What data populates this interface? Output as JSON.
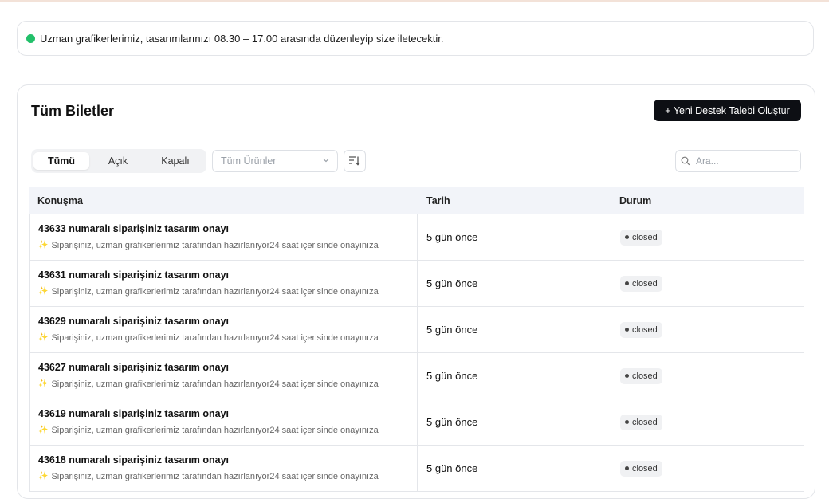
{
  "notice": {
    "text": "Uzman grafikerlerimiz, tasarımlarınızı 08.30 – 17.00 arasında düzenleyip size iletecektir.",
    "status_color": "#22c06a"
  },
  "card": {
    "title": "Tüm Biletler",
    "new_button": "+ Yeni Destek Talebi Oluştur"
  },
  "filters": {
    "tabs": [
      {
        "label": "Tümü",
        "active": true
      },
      {
        "label": "Açık",
        "active": false
      },
      {
        "label": "Kapalı",
        "active": false
      }
    ],
    "product_select": "Tüm Ürünler",
    "search_placeholder": "Ara..."
  },
  "table": {
    "headers": {
      "conversation": "Konuşma",
      "date": "Tarih",
      "status": "Durum"
    },
    "rows": [
      {
        "title": "43633 numaralı siparişiniz tasarım onayı",
        "desc": "Siparişiniz, uzman grafikerlerimiz tarafından hazırlanıyor24 saat içerisinde onayınıza",
        "date": "5 gün önce",
        "status": "closed"
      },
      {
        "title": "43631 numaralı siparişiniz tasarım onayı",
        "desc": "Siparişiniz, uzman grafikerlerimiz tarafından hazırlanıyor24 saat içerisinde onayınıza",
        "date": "5 gün önce",
        "status": "closed"
      },
      {
        "title": "43629 numaralı siparişiniz tasarım onayı",
        "desc": "Siparişiniz, uzman grafikerlerimiz tarafından hazırlanıyor24 saat içerisinde onayınıza",
        "date": "5 gün önce",
        "status": "closed"
      },
      {
        "title": "43627 numaralı siparişiniz tasarım onayı",
        "desc": "Siparişiniz, uzman grafikerlerimiz tarafından hazırlanıyor24 saat içerisinde onayınıza",
        "date": "5 gün önce",
        "status": "closed"
      },
      {
        "title": "43619 numaralı siparişiniz tasarım onayı",
        "desc": "Siparişiniz, uzman grafikerlerimiz tarafından hazırlanıyor24 saat içerisinde onayınıza",
        "date": "5 gün önce",
        "status": "closed"
      },
      {
        "title": "43618 numaralı siparişiniz tasarım onayı",
        "desc": "Siparişiniz, uzman grafikerlerimiz tarafından hazırlanıyor24 saat içerisinde onayınıza",
        "date": "5 gün önce",
        "status": "closed"
      }
    ]
  },
  "icons": {
    "status_dot": "dot-icon",
    "chevron": "chevron-down-icon",
    "sort": "sort-icon",
    "search": "search-icon",
    "sparkle": "sparkle-icon"
  }
}
